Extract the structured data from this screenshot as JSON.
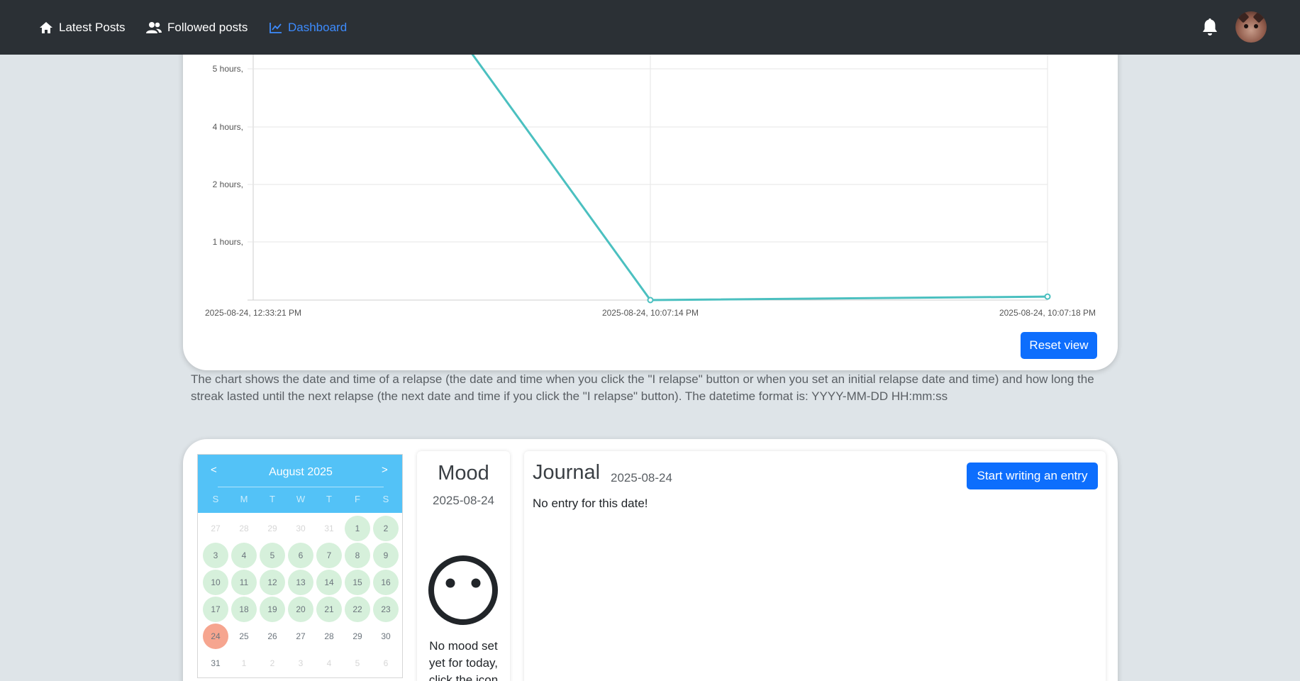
{
  "nav": {
    "items": [
      {
        "label": "Latest Posts",
        "icon": "home-icon"
      },
      {
        "label": "Followed posts",
        "icon": "users-icon"
      },
      {
        "label": "Dashboard",
        "icon": "chart-line-icon"
      }
    ],
    "active": "Dashboard",
    "right_icons": [
      "bell-icon",
      "avatar"
    ]
  },
  "chart_data": {
    "type": "line",
    "x": [
      "2025-08-24, 12:33:21 PM",
      "2025-08-24, 10:07:14 PM",
      "2025-08-24, 10:07:18 PM"
    ],
    "x_tick_labels": [
      "2025-08-24, 12:33:21 PM",
      "2025-08-24, 10:07:14 PM",
      "2025-08-24, 10:07:18 PM"
    ],
    "y_tick_labels": [
      "5 hours,",
      "4 hours,",
      "2 hours,",
      "1 hours,"
    ],
    "series": [
      {
        "values": [
          9.5,
          0,
          0.06
        ],
        "color": "#4bc0c0"
      }
    ],
    "grid": true,
    "title": "",
    "xlabel": "",
    "ylabel": ""
  },
  "chart": {
    "reset_label": "Reset view",
    "description": "The chart shows the date and time of a relapse (the date and time when you click the \"I relapse\" button or when you set an initial relapse date and time) and how long the streak lasted until the next relapse (the next date and time if you click the \"I relapse\" button). The datetime format is: YYYY-MM-DD HH:mm:ss"
  },
  "calendar": {
    "prev": "<",
    "next": ">",
    "title": "August 2025",
    "weekdays": [
      "S",
      "M",
      "T",
      "W",
      "T",
      "F",
      "S"
    ],
    "weeks": [
      [
        "27",
        "28",
        "29",
        "30",
        "31",
        "1",
        "2"
      ],
      [
        "3",
        "4",
        "5",
        "6",
        "7",
        "8",
        "9"
      ],
      [
        "10",
        "11",
        "12",
        "13",
        "14",
        "15",
        "16"
      ],
      [
        "17",
        "18",
        "19",
        "20",
        "21",
        "22",
        "23"
      ],
      [
        "24",
        "25",
        "26",
        "27",
        "28",
        "29",
        "30"
      ],
      [
        "31",
        "1",
        "2",
        "3",
        "4",
        "5",
        "6"
      ]
    ],
    "today": "24",
    "colors": {
      "header": "#53c2f7",
      "logged": "#d6f0db",
      "today": "#f6a58f"
    }
  },
  "mood": {
    "title": "Mood",
    "date": "2025-08-24",
    "icon": "neutral-face-icon",
    "text": "No mood set yet for today, click the icon"
  },
  "journal": {
    "title": "Journal",
    "date": "2025-08-24",
    "button_label": "Start writing an entry",
    "empty_text": "No entry for this date!"
  },
  "colors": {
    "navbar": "#2b3035",
    "accent": "#0d6efd",
    "page_bg": "#dee4e8"
  }
}
